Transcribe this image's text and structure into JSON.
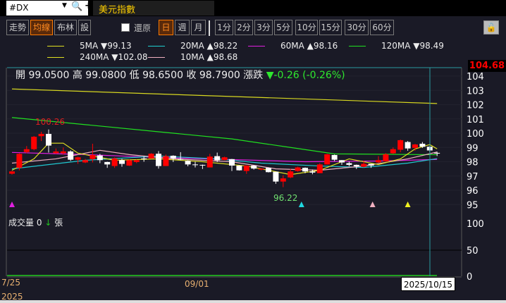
{
  "symbol": {
    "value": "#DX",
    "dropdown_icon": "▼",
    "search_icon": "🔍",
    "add_icon": "+"
  },
  "title": "美元指數",
  "toolbar": {
    "tabs": [
      {
        "label": "走勢",
        "active": false
      },
      {
        "label": "均線",
        "active": true
      },
      {
        "label": "布林",
        "active": false
      },
      {
        "label": "設",
        "active": false
      }
    ],
    "restore_label": "還原",
    "restore_checked": false,
    "periods": [
      {
        "label": "日",
        "active": true
      },
      {
        "label": "週"
      },
      {
        "label": "月"
      },
      {
        "label": "1分"
      },
      {
        "label": "2分"
      },
      {
        "label": "3分"
      },
      {
        "label": "5分"
      },
      {
        "label": "10分"
      },
      {
        "label": "15分"
      },
      {
        "label": "30分"
      },
      {
        "label": "60分"
      }
    ],
    "lock_icon": "🔓"
  },
  "legend": [
    {
      "name": "5MA",
      "dir": "▼",
      "value": "99.13",
      "color": "#e0e020"
    },
    {
      "name": "20MA",
      "dir": "▲",
      "value": "98.22",
      "color": "#20d0d0"
    },
    {
      "name": "60MA",
      "dir": "▲",
      "value": "98.16",
      "color": "#e020e0"
    },
    {
      "name": "120MA",
      "dir": "▼",
      "value": "98.49",
      "color": "#20e020"
    },
    {
      "name": "240MA",
      "dir": "▼",
      "value": "102.08",
      "color": "#e0e020"
    },
    {
      "name": "10MA",
      "dir": "▲",
      "value": "98.68",
      "color": "#f0b0c0"
    }
  ],
  "ohlc": {
    "open_label": "開",
    "open": "99.0500",
    "high_label": "高",
    "high": "99.0800",
    "low_label": "低",
    "low": "98.6500",
    "close_label": "收",
    "close": "98.7900",
    "change_label": "漲跌",
    "change": "▼-0.26 (-0.26%)"
  },
  "current_price": "104.68",
  "price_axis": [
    "104",
    "103",
    "102",
    "101",
    "100",
    "99",
    "98",
    "97",
    "96",
    "95"
  ],
  "volume": {
    "label": "成交量",
    "value": "0",
    "arrow": "↓",
    "unit": "張",
    "axis": [
      "100",
      "50",
      "0"
    ]
  },
  "x_labels": {
    "start": "7/25",
    "year": "2025",
    "mid": "09/01"
  },
  "cursor_date": "2025/10/15",
  "annotations": {
    "high": "100.26",
    "low": "96.22"
  },
  "colors": {
    "up": "#ff0000",
    "down": "#ffffff",
    "bg": "#1a1a26"
  },
  "chart_data": {
    "type": "candlestick",
    "ylim": [
      95,
      104
    ],
    "candles": [
      [
        97.16,
        97.35,
        97.1,
        97.32
      ],
      [
        97.57,
        98.6,
        97.4,
        98.55
      ],
      [
        98.68,
        99.1,
        98.6,
        98.88
      ],
      [
        98.88,
        99.8,
        98.8,
        99.75
      ],
      [
        99.79,
        100.1,
        99.45,
        99.95
      ],
      [
        99.95,
        100.26,
        98.64,
        99.13
      ],
      [
        98.6,
        98.93,
        98.55,
        98.72
      ],
      [
        98.6,
        99.0,
        98.5,
        98.72
      ],
      [
        98.72,
        98.8,
        98.05,
        98.14
      ],
      [
        98.14,
        98.35,
        97.85,
        98.31
      ],
      [
        97.95,
        98.2,
        97.9,
        98.11
      ],
      [
        98.19,
        99.26,
        97.95,
        98.47
      ],
      [
        98.44,
        98.55,
        97.9,
        98.11
      ],
      [
        97.98,
        98.0,
        97.57,
        97.81
      ],
      [
        97.7,
        98.3,
        97.57,
        98.23
      ],
      [
        98.11,
        98.2,
        97.65,
        97.85
      ],
      [
        97.73,
        98.15,
        97.7,
        98.11
      ],
      [
        97.98,
        98.15,
        97.9,
        98.11
      ],
      [
        98.23,
        98.36,
        98.0,
        98.18
      ],
      [
        98.23,
        98.6,
        98.2,
        98.56
      ],
      [
        98.56,
        98.75,
        97.52,
        97.7
      ],
      [
        97.7,
        98.5,
        97.7,
        98.39
      ],
      [
        98.42,
        98.45,
        97.98,
        98.23
      ],
      [
        98.19,
        98.67,
        98.1,
        98.14
      ],
      [
        98.06,
        98.1,
        97.68,
        97.81
      ],
      [
        97.81,
        98.0,
        97.6,
        97.76
      ],
      [
        97.78,
        97.8,
        97.49,
        97.75
      ],
      [
        97.6,
        98.55,
        97.6,
        98.36
      ],
      [
        98.39,
        98.64,
        97.98,
        98.1
      ],
      [
        98.12,
        98.35,
        98.1,
        98.31
      ],
      [
        98.18,
        98.2,
        97.35,
        97.73
      ],
      [
        97.73,
        97.75,
        97.38,
        97.4
      ],
      [
        97.35,
        97.75,
        97.15,
        97.73
      ],
      [
        97.73,
        97.75,
        97.45,
        97.52
      ],
      [
        97.45,
        97.55,
        97.4,
        97.52
      ],
      [
        97.57,
        97.6,
        97.25,
        97.27
      ],
      [
        97.3,
        97.3,
        96.45,
        96.61
      ],
      [
        96.61,
        97.05,
        96.22,
        96.83
      ],
      [
        96.9,
        97.5,
        96.85,
        97.32
      ],
      [
        97.35,
        97.65,
        97.3,
        97.6
      ],
      [
        97.57,
        97.6,
        97.2,
        97.32
      ],
      [
        97.32,
        97.45,
        97.12,
        97.24
      ],
      [
        97.2,
        97.9,
        97.2,
        97.81
      ],
      [
        97.81,
        98.55,
        97.8,
        98.52
      ],
      [
        98.47,
        98.5,
        98.05,
        98.14
      ],
      [
        98.11,
        98.12,
        97.78,
        97.95
      ],
      [
        97.9,
        98.0,
        97.68,
        97.78
      ],
      [
        97.78,
        97.8,
        97.49,
        97.68
      ],
      [
        97.65,
        98.07,
        97.6,
        97.85
      ],
      [
        97.85,
        97.86,
        97.57,
        97.73
      ],
      [
        97.95,
        98.39,
        97.92,
        98.11
      ],
      [
        98.03,
        98.6,
        98.0,
        98.52
      ],
      [
        98.59,
        99.0,
        98.55,
        98.88
      ],
      [
        98.84,
        99.55,
        98.67,
        99.51
      ],
      [
        99.38,
        99.45,
        98.77,
        98.93
      ],
      [
        98.97,
        99.25,
        98.77,
        99.21
      ],
      [
        99.26,
        99.38,
        98.97,
        99.05
      ],
      [
        99.05,
        99.08,
        98.65,
        98.79
      ],
      [
        98.62,
        98.7,
        98.4,
        98.57
      ]
    ],
    "ma": [
      {
        "name": "240MA",
        "color": "#d8d820",
        "points": [
          [
            0,
            103.1
          ],
          [
            58,
            102.08
          ]
        ]
      },
      {
        "name": "120MA",
        "color": "#20e020",
        "points": [
          [
            0,
            101.1
          ],
          [
            10,
            100.6
          ],
          [
            20,
            100.1
          ],
          [
            30,
            99.6
          ],
          [
            38,
            99.0
          ],
          [
            44,
            98.55
          ],
          [
            58,
            98.49
          ]
        ]
      },
      {
        "name": "60MA",
        "color": "#e020e0",
        "points": [
          [
            0,
            98.65
          ],
          [
            10,
            98.5
          ],
          [
            20,
            98.3
          ],
          [
            30,
            98.15
          ],
          [
            40,
            98.0
          ],
          [
            50,
            98.05
          ],
          [
            58,
            98.16
          ]
        ]
      },
      {
        "name": "20MA",
        "color": "#20c8d0",
        "points": [
          [
            0,
            97.5
          ],
          [
            10,
            98.1
          ],
          [
            20,
            98.4
          ],
          [
            28,
            98.2
          ],
          [
            34,
            97.9
          ],
          [
            42,
            97.7
          ],
          [
            48,
            97.6
          ],
          [
            54,
            97.9
          ],
          [
            58,
            98.22
          ]
        ]
      },
      {
        "name": "10MA",
        "color": "#f0b0c0",
        "points": [
          [
            0,
            97.9
          ],
          [
            6,
            98.2
          ],
          [
            12,
            98.8
          ],
          [
            16,
            98.5
          ],
          [
            22,
            98.2
          ],
          [
            30,
            98.0
          ],
          [
            36,
            97.5
          ],
          [
            42,
            97.4
          ],
          [
            48,
            97.7
          ],
          [
            54,
            98.2
          ],
          [
            58,
            98.68
          ]
        ]
      },
      {
        "name": "5MA",
        "color": "#e0e020",
        "points": [
          [
            0,
            97.4
          ],
          [
            3,
            98.2
          ],
          [
            5,
            99.3
          ],
          [
            7,
            99.3
          ],
          [
            9,
            98.6
          ],
          [
            14,
            98.1
          ],
          [
            20,
            98.2
          ],
          [
            26,
            98.0
          ],
          [
            32,
            97.7
          ],
          [
            38,
            97.1
          ],
          [
            42,
            97.4
          ],
          [
            46,
            98.2
          ],
          [
            50,
            97.8
          ],
          [
            53,
            98.2
          ],
          [
            55,
            98.9
          ],
          [
            57,
            99.2
          ],
          [
            58,
            98.9
          ]
        ]
      }
    ],
    "markers": [
      {
        "index": 0,
        "color": "#e020e0"
      },
      {
        "index": 39.5,
        "color": "#20d8e0"
      },
      {
        "index": 49.2,
        "color": "#f0b0c0"
      },
      {
        "index": 54,
        "color": "#f0f020"
      }
    ]
  }
}
